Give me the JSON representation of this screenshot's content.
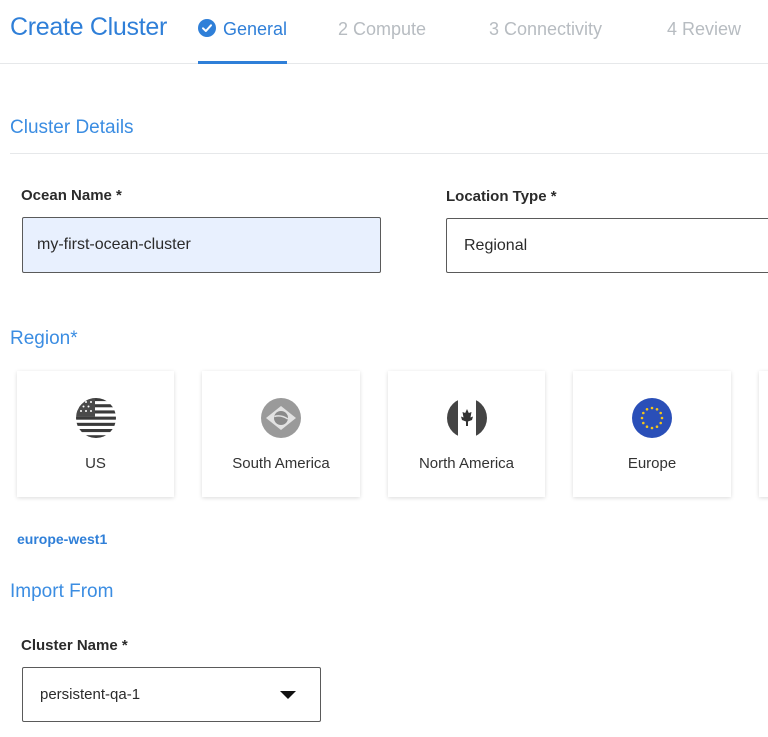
{
  "header": {
    "title": "Create Cluster",
    "steps": [
      {
        "label": "General",
        "state": "active",
        "icon": "check-circle-icon"
      },
      {
        "label": "2 Compute",
        "state": "inactive"
      },
      {
        "label": "3 Connectivity",
        "state": "inactive"
      },
      {
        "label": "4 Review",
        "state": "inactive"
      }
    ]
  },
  "cluster_details": {
    "title": "Cluster Details",
    "ocean_name": {
      "label": "Ocean Name *",
      "value": "my-first-ocean-cluster"
    },
    "location_type": {
      "label": "Location Type *",
      "value": "Regional"
    }
  },
  "region": {
    "title": "Region*",
    "options": [
      {
        "label": "US",
        "icon": "us-flag-icon"
      },
      {
        "label": "South America",
        "icon": "brazil-flag-icon"
      },
      {
        "label": "North America",
        "icon": "canada-flag-icon"
      },
      {
        "label": "Europe",
        "icon": "eu-flag-icon"
      }
    ],
    "selected_region": "europe-west1"
  },
  "import_from": {
    "title": "Import From",
    "cluster_name": {
      "label": "Cluster Name *",
      "value": "persistent-qa-1"
    }
  },
  "colors": {
    "accent": "#2f7fd8",
    "inactive_step": "#b7bcc1",
    "autofill_bg": "#e8f0fe",
    "eu_blue": "#2a4fb8",
    "eu_star": "#f5c518"
  }
}
